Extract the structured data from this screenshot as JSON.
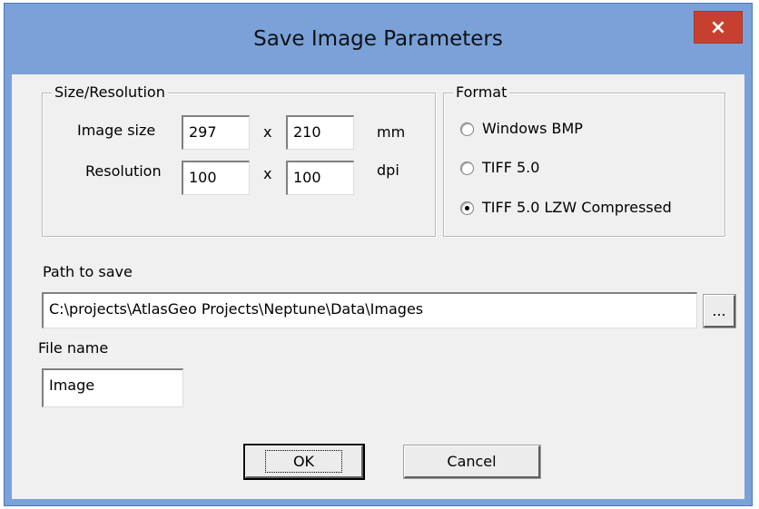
{
  "window": {
    "title": "Save Image Parameters",
    "close_symbol": "×"
  },
  "size_group": {
    "label": "Size/Resolution",
    "image_size_label": "Image size",
    "image_width": "297",
    "image_height": "210",
    "image_unit": "mm",
    "resolution_label": "Resolution",
    "res_x": "100",
    "res_y": "100",
    "res_unit": "dpi",
    "separator": "x"
  },
  "format_group": {
    "label": "Format",
    "options": [
      {
        "label": "Windows BMP",
        "selected": false
      },
      {
        "label": "TIFF 5.0",
        "selected": false
      },
      {
        "label": "TIFF 5.0 LZW Compressed",
        "selected": true
      }
    ]
  },
  "path": {
    "label": "Path to save",
    "value": "C:\\projects\\AtlasGeo Projects\\Neptune\\Data\\Images",
    "browse_label": "..."
  },
  "file": {
    "label": "File name",
    "value": "Image"
  },
  "buttons": {
    "ok": "OK",
    "cancel": "Cancel"
  },
  "colors": {
    "frame": "#7aa1d8",
    "close_button": "#c7402f",
    "client": "#f0f0f0"
  }
}
